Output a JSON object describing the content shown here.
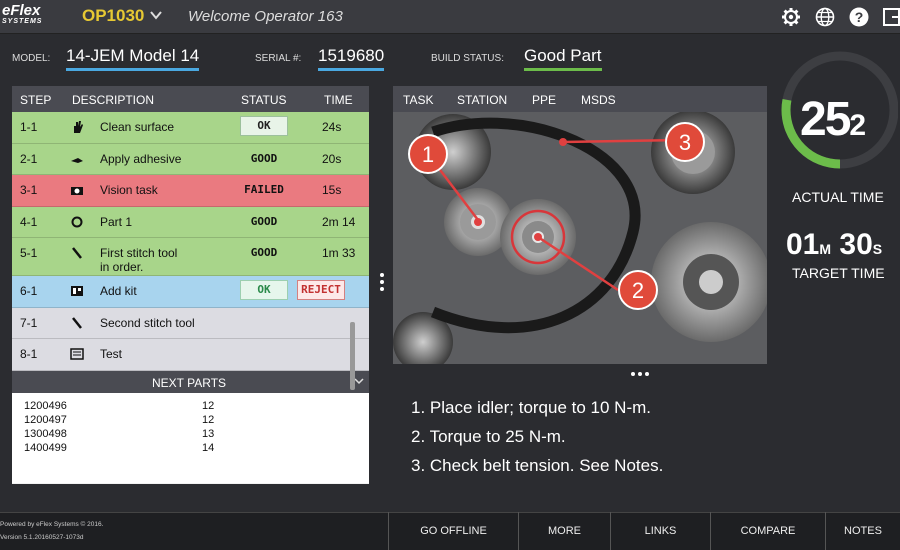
{
  "header": {
    "logo_line1": "eFlex",
    "logo_line2": "SYSTEMS",
    "station": "OP1030",
    "welcome": "Welcome Operator 163",
    "icons": [
      "gear-icon",
      "globe-icon",
      "help-icon",
      "logout-icon"
    ]
  },
  "info": {
    "model_label": "MODEL:",
    "model_value": "14-JEM Model 14",
    "serial_label": "SERIAL #:",
    "serial_value": "1519680",
    "build_label": "BUILD STATUS:",
    "build_value": "Good Part"
  },
  "steps": {
    "headers": {
      "step": "STEP",
      "description": "DESCRIPTION",
      "status": "STATUS",
      "time": "TIME"
    },
    "rows": [
      {
        "step": "1-1",
        "icon": "hand-icon",
        "desc": "Clean surface",
        "status": "OK",
        "time": "24s",
        "color": "#a8d58a"
      },
      {
        "step": "2-1",
        "icon": "glue-icon",
        "desc": "Apply adhesive",
        "status": "GOOD",
        "time": "20s",
        "color": "#a8d58a"
      },
      {
        "step": "3-1",
        "icon": "camera-icon",
        "desc": "Vision task",
        "status": "FAILED",
        "time": "15s",
        "color": "#ea7a80"
      },
      {
        "step": "4-1",
        "icon": "ring-icon",
        "desc": "Part 1",
        "status": "GOOD",
        "time": "2m 14",
        "color": "#a8d58a"
      },
      {
        "step": "5-1",
        "icon": "stitch-tool-icon",
        "desc": "First stitch tool\nin order.",
        "status": "GOOD",
        "time": "1m 33",
        "color": "#a8d58a"
      },
      {
        "step": "6-1",
        "icon": "kit-icon",
        "desc": "Add kit",
        "ok": "OK",
        "reject": "REJECT",
        "color": "#a8d4ee"
      },
      {
        "step": "7-1",
        "icon": "stitch-tool-icon",
        "desc": "Second stitch tool",
        "color": "#dcdce2"
      },
      {
        "step": "8-1",
        "icon": "test-icon",
        "desc": "Test",
        "color": "#dcdce2"
      }
    ]
  },
  "next_parts": {
    "title": "NEXT PARTS",
    "rows": [
      {
        "part": "1200496",
        "qty": "12"
      },
      {
        "part": "1200497",
        "qty": "12"
      },
      {
        "part": "1300498",
        "qty": "13"
      },
      {
        "part": "1400499",
        "qty": "14"
      }
    ]
  },
  "tabs": [
    "TASK",
    "STATION",
    "PPE",
    "MSDS"
  ],
  "callouts": [
    "1",
    "2",
    "3"
  ],
  "instructions": [
    "1. Place idler; torque to 10 N-m.",
    "2. Torque to 25 N-m.",
    "3. Check belt tension.  See Notes."
  ],
  "timer": {
    "actual_main": "25",
    "actual_sub": "2",
    "actual_label": "ACTUAL TIME",
    "target_min": "01",
    "target_min_unit": "M",
    "target_sec": "30",
    "target_sec_unit": "S",
    "target_label": "TARGET TIME",
    "ring_progress": 0.28,
    "ring_color": "#6cbc4a"
  },
  "footer": {
    "powered": "Powered by eFlex Systems © 2016.",
    "version": "Version 5.1.20160527-1073d",
    "buttons": [
      "GO OFFLINE",
      "MORE",
      "LINKS",
      "COMPARE",
      "NOTES"
    ]
  }
}
